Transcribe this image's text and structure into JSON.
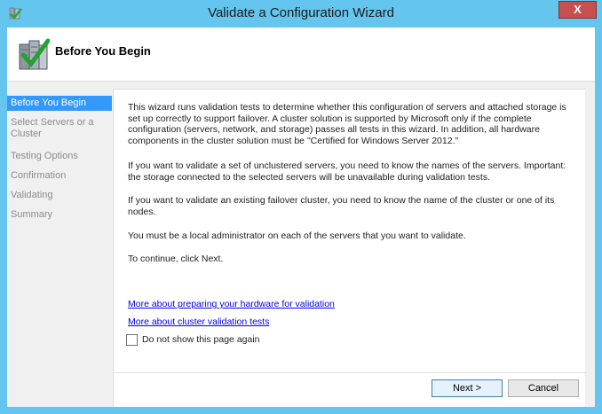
{
  "window": {
    "title": "Validate a Configuration Wizard",
    "close_label": "X"
  },
  "header": {
    "title": "Before You Begin"
  },
  "nav": {
    "items": [
      {
        "label": "Before You Begin",
        "active": true
      },
      {
        "label": "Select Servers or a\nCluster",
        "active": false
      },
      {
        "label": "Testing Options",
        "active": false
      },
      {
        "label": "Confirmation",
        "active": false
      },
      {
        "label": "Validating",
        "active": false
      },
      {
        "label": "Summary",
        "active": false
      }
    ]
  },
  "content": {
    "paragraphs": [
      "This wizard runs validation tests to determine whether this configuration of servers and attached storage is set up correctly to support failover. A cluster solution is supported by Microsoft only if the complete configuration (servers, network, and storage) passes all tests in this wizard. In addition, all hardware components in the cluster solution must be \"Certified for Windows Server 2012.\"",
      "If you want to validate a set of unclustered servers, you need to know the names of the servers. Important: the storage connected to the selected servers will be unavailable during validation tests.",
      "If you want to validate an existing failover cluster, you need to know the name of the cluster or one of its nodes.",
      "You must be a local administrator on each of the servers that you want to validate.",
      "To continue, click Next."
    ],
    "links": [
      "More about preparing your hardware for validation",
      "More about cluster validation tests"
    ],
    "checkbox_label": "Do not show this page again",
    "checkbox_checked": false
  },
  "buttons": {
    "next": "Next >",
    "cancel": "Cancel"
  },
  "colors": {
    "window_frame": "#64c6ee",
    "close_button": "#c74f50",
    "nav_active": "#3399ff",
    "link": "#0000ee"
  },
  "icons": {
    "app": "cluster-wizard-icon",
    "header": "server-check-icon",
    "close": "close-icon"
  }
}
